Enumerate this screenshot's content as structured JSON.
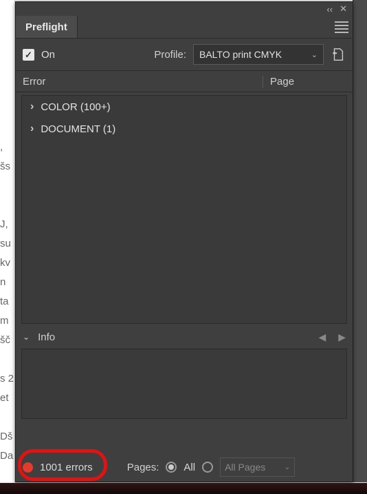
{
  "bg_strip": "\n\n\n\n\n,\nšs\n\n\nJ,\nsu\nkv\nn\nta\nm\nšč\n\ns 2\net\n\nDš\nDa\n",
  "panel": {
    "tab_title": "Preflight",
    "on_label": "On",
    "on_checked": true,
    "profile_label": "Profile:",
    "profile_value": "BALTO print CMYK",
    "headers": {
      "error": "Error",
      "page": "Page"
    },
    "tree": [
      {
        "label": "COLOR (100+)"
      },
      {
        "label": "DOCUMENT (1)"
      }
    ],
    "info_label": "Info",
    "status_text": "1001 errors",
    "pages_label": "Pages:",
    "radio_all": "All",
    "range_value": "All Pages"
  }
}
